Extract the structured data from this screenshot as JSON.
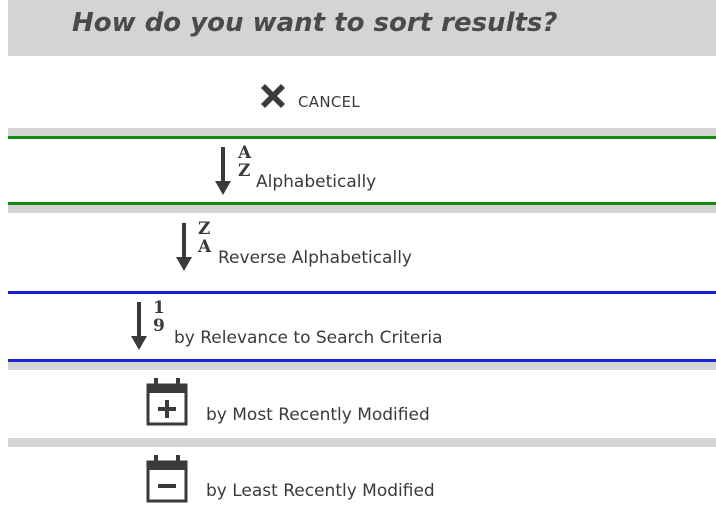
{
  "header": {
    "title": "How do you want to sort results?"
  },
  "options": [
    {
      "label": "CANCEL",
      "icon": "close-icon"
    },
    {
      "label": "Alphabetically",
      "icon": "sort-a-z-icon",
      "top": "A",
      "bottom": "Z",
      "state": "selected"
    },
    {
      "label": "Reverse Alphabetically",
      "icon": "sort-z-a-icon",
      "top": "Z",
      "bottom": "A"
    },
    {
      "label": "by Relevance to Search Criteria",
      "icon": "sort-1-9-icon",
      "top": "1",
      "bottom": "9",
      "state": "selected"
    },
    {
      "label": "by Most Recently Modified",
      "icon": "calendar-plus-icon"
    },
    {
      "label": "by Least Recently Modified",
      "icon": "calendar-minus-icon"
    }
  ],
  "colors": {
    "header_bg": "#d4d4d4",
    "text": "#3a3a3a",
    "green_border": "#128a12",
    "blue_border": "#1a22d6"
  }
}
